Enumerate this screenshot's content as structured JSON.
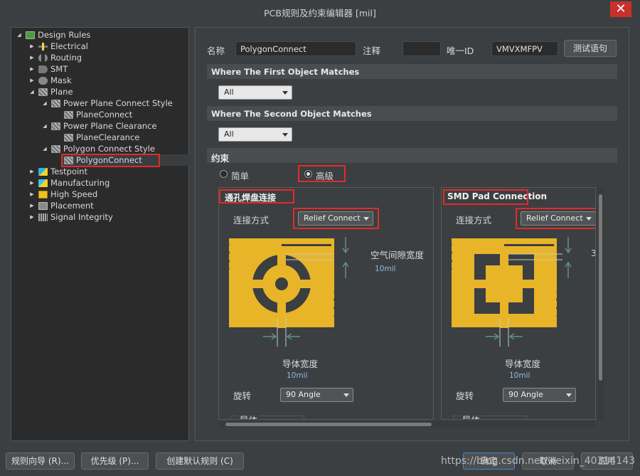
{
  "window": {
    "title": "PCB规则及约束编辑器 [mil]",
    "close_glyph": "✕"
  },
  "tree": {
    "root": "Design Rules",
    "items": [
      {
        "label": "Electrical",
        "icon": "electrical-icon"
      },
      {
        "label": "Routing",
        "icon": "routing-icon"
      },
      {
        "label": "SMT",
        "icon": "smt-icon"
      },
      {
        "label": "Mask",
        "icon": "mask-icon"
      },
      {
        "label": "Plane",
        "icon": "plane-icon"
      },
      {
        "label": "Power Plane Connect Style",
        "icon": "rule-icon"
      },
      {
        "label": "PlaneConnect",
        "icon": "rule-icon"
      },
      {
        "label": "Power Plane Clearance",
        "icon": "rule-icon"
      },
      {
        "label": "PlaneClearance",
        "icon": "rule-icon"
      },
      {
        "label": "Polygon Connect Style",
        "icon": "rule-icon"
      },
      {
        "label": "PolygonConnect",
        "icon": "rule-icon"
      },
      {
        "label": "Testpoint",
        "icon": "testpoint-icon"
      },
      {
        "label": "Manufacturing",
        "icon": "manufacturing-icon"
      },
      {
        "label": "High Speed",
        "icon": "high-speed-icon"
      },
      {
        "label": "Placement",
        "icon": "placement-icon"
      },
      {
        "label": "Signal Integrity",
        "icon": "signal-integrity-icon"
      }
    ]
  },
  "header": {
    "name_label": "名称",
    "name_value": "PolygonConnect",
    "comment_label": "注释",
    "comment_value": "",
    "uid_label": "唯一ID",
    "uid_value": "VMVXMFPV",
    "test_button": "测试语句"
  },
  "first_match": {
    "title": "Where The First Object Matches",
    "value": "All"
  },
  "second_match": {
    "title": "Where The Second Object Matches",
    "value": "All"
  },
  "constraints": {
    "title": "约束",
    "simple_label": "简单",
    "advanced_label": "高级",
    "mode_selected": "advanced"
  },
  "via_pane": {
    "title": "通孔焊盘连接",
    "connect_label": "连接方式",
    "connect_value": "Relief Connect",
    "air_gap_label": "空气间隙宽度",
    "air_gap_value": "10mil",
    "conductor_label": "导体宽度",
    "conductor_value": "10mil",
    "rotation_label": "旋转",
    "rotation_value": "90 Angle",
    "conductors_label": "导体"
  },
  "smd_pane": {
    "title": "SMD Pad Connection",
    "connect_label": "连接方式",
    "connect_value": "Relief Connect",
    "air_gap_clip": "3",
    "conductor_label": "导体宽度",
    "conductor_value": "10mil",
    "rotation_label": "旋转",
    "rotation_value": "90 Angle",
    "conductors_label": "导体"
  },
  "footer": {
    "wizard": "规则向导 (R)...",
    "priority": "优先级 (P)...",
    "default_rules": "创建默认规则 (C)",
    "ok": "确定",
    "cancel": "取消",
    "apply": "应用",
    "watermark": "https://blog.csdn.net/weixin_40314143"
  },
  "colors": {
    "copper": "#e8b528",
    "highlight": "#e12b2b",
    "panel": "#3c3f41"
  }
}
